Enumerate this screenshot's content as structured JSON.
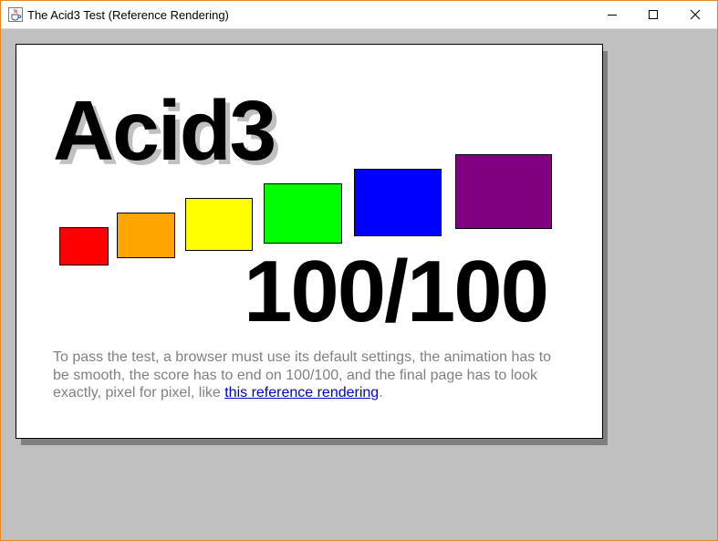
{
  "window": {
    "title": "The Acid3 Test (Reference Rendering)",
    "app_icon": "java-cup-icon",
    "controls": {
      "minimize_icon": "minimize-icon",
      "maximize_icon": "maximize-icon",
      "close_icon": "close-icon"
    }
  },
  "page": {
    "heading": "Acid3",
    "score": "100/100",
    "boxes": [
      {
        "name": "red",
        "color": "#ff0000"
      },
      {
        "name": "orange",
        "color": "#ffa500"
      },
      {
        "name": "yellow",
        "color": "#ffff00"
      },
      {
        "name": "lime",
        "color": "#00ff00"
      },
      {
        "name": "blue",
        "color": "#0000ff"
      },
      {
        "name": "purple",
        "color": "#800080"
      }
    ],
    "description_prefix": "To pass the test, a browser must use its default settings, the animation has to be smooth, the score has to end on 100/100, and the final page has to look exactly, pixel for pixel, like ",
    "reference_link": "this reference rendering",
    "description_suffix": "."
  },
  "colors": {
    "background": "#c0c0c0",
    "panel": "#ffffff",
    "text_gray": "#808080",
    "link": "#0000cc",
    "window_border": "#e0892a"
  }
}
